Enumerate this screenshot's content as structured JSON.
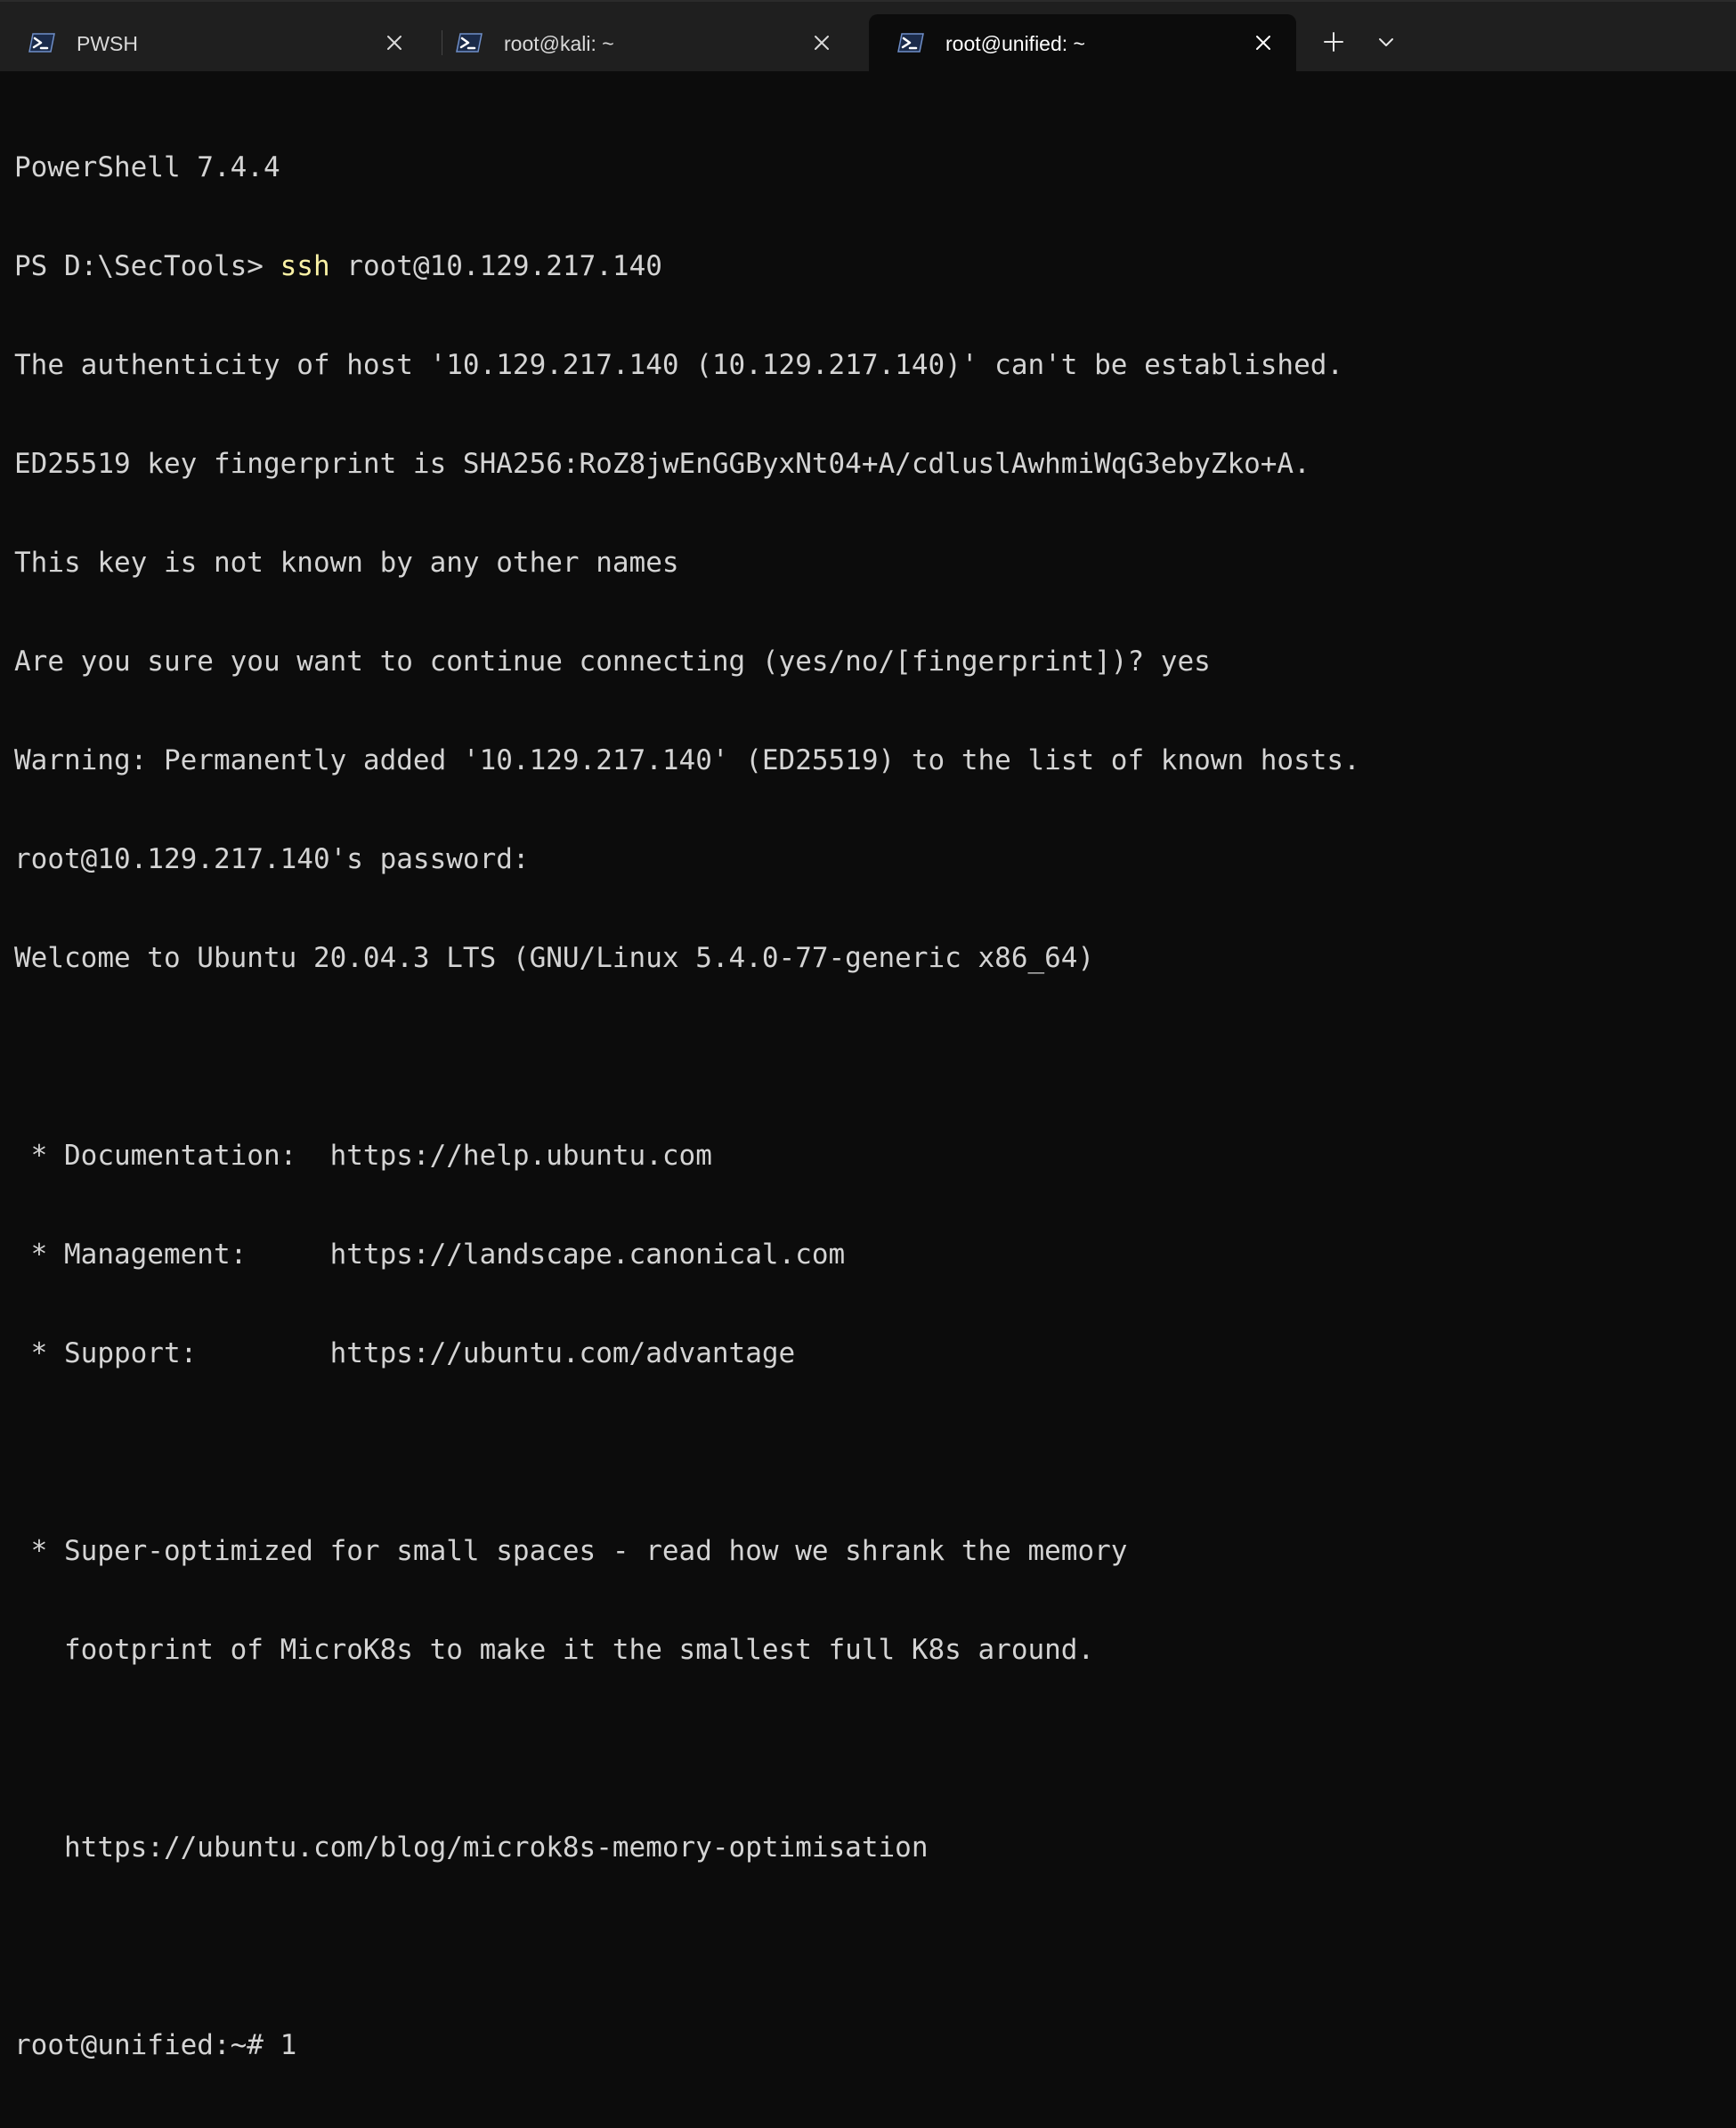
{
  "tabs": [
    {
      "label": "PWSH",
      "icon": "powershell-icon",
      "active": false
    },
    {
      "label": "root@kali: ~",
      "icon": "powershell-icon",
      "active": false
    },
    {
      "label": "root@unified: ~",
      "icon": "powershell-icon",
      "active": true
    }
  ],
  "toolbar": {
    "new_tab_icon": "plus-icon",
    "dropdown_icon": "chevron-down-icon"
  },
  "terminal": {
    "prompt_prefix": "PS D:\\SecTools> ",
    "command_name": "ssh",
    "command_args": " root@10.129.217.140",
    "lines": [
      "PowerShell 7.4.4",
      "The authenticity of host '10.129.217.140 (10.129.217.140)' can't be established.",
      "ED25519 key fingerprint is SHA256:RoZ8jwEnGGByxNt04+A/cdluslAwhmiWqG3ebyZko+A.",
      "This key is not known by any other names",
      "Are you sure you want to continue connecting (yes/no/[fingerprint])? yes",
      "Warning: Permanently added '10.129.217.140' (ED25519) to the list of known hosts.",
      "root@10.129.217.140's password:",
      "Welcome to Ubuntu 20.04.3 LTS (GNU/Linux 5.4.0-77-generic x86_64)",
      "",
      " * Documentation:  https://help.ubuntu.com",
      " * Management:     https://landscape.canonical.com",
      " * Support:        https://ubuntu.com/advantage",
      "",
      " * Super-optimized for small spaces - read how we shrank the memory",
      "   footprint of MicroK8s to make it the smallest full K8s around.",
      "",
      "   https://ubuntu.com/blog/microk8s-memory-optimisation",
      "",
      "root@unified:~# 1"
    ]
  },
  "colors": {
    "background": "#0c0c0c",
    "tabbar": "#1f1f1f",
    "text": "#d4d4d4",
    "command": "#f9f1a5"
  }
}
